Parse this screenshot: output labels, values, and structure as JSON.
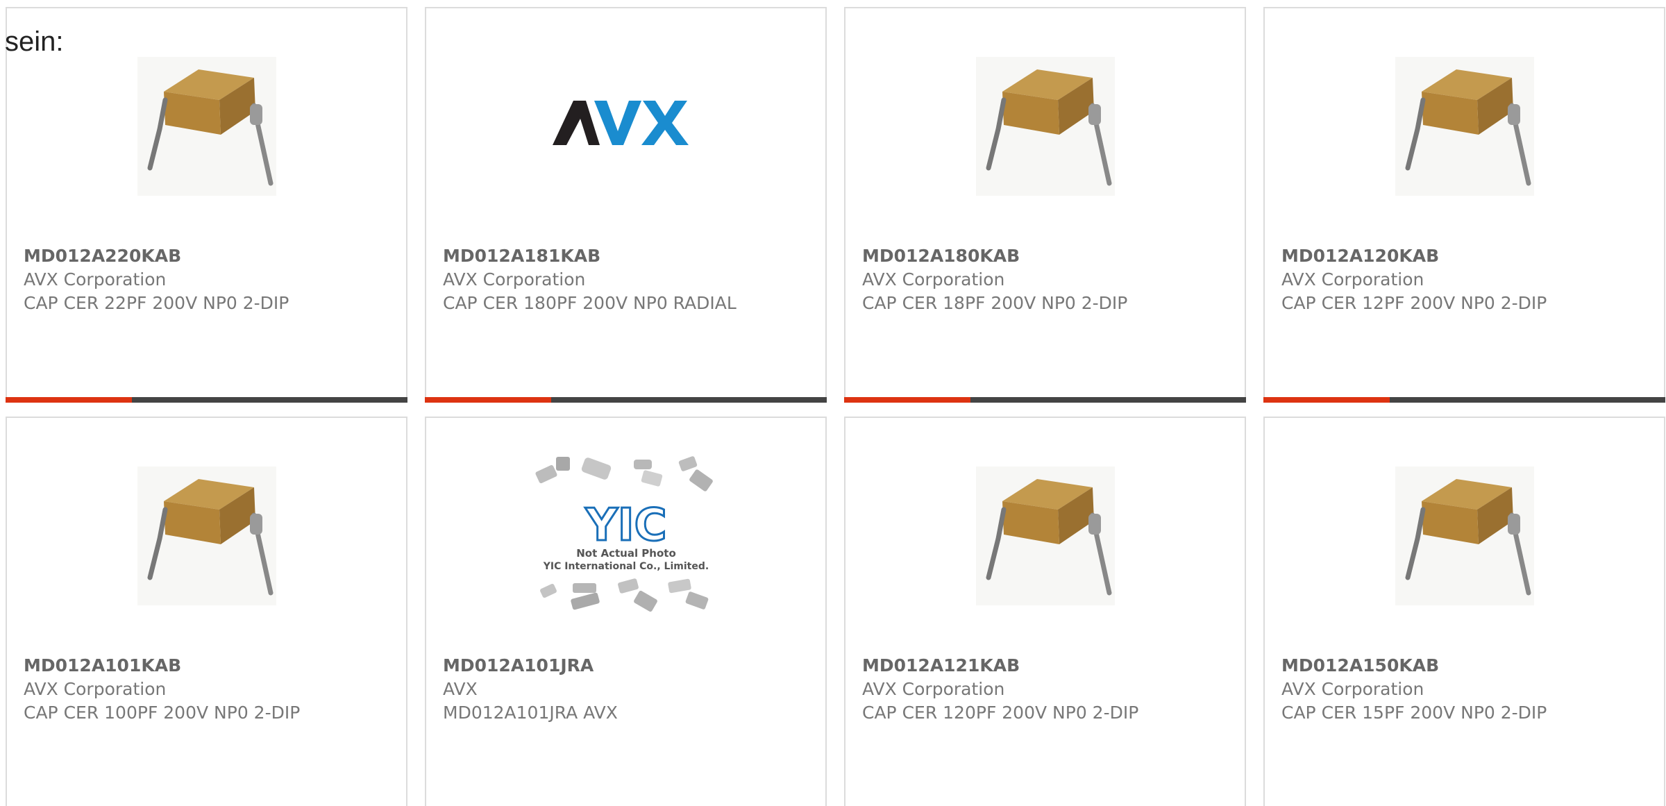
{
  "intro_text": "sein:",
  "colors": {
    "accent": "#dd3311",
    "bar_dark": "#444444",
    "card_border": "#dcdcdc",
    "text": "#777777"
  },
  "products": [
    {
      "part_number": "MD012A220KAB",
      "manufacturer": "AVX Corporation",
      "description": "CAP CER 22PF 200V NP0 2-DIP",
      "image": "capacitor-photo"
    },
    {
      "part_number": "MD012A181KAB",
      "manufacturer": "AVX Corporation",
      "description": "CAP CER 180PF 200V NP0 RADIAL",
      "image": "avx-logo",
      "logo_text": "AVX"
    },
    {
      "part_number": "MD012A180KAB",
      "manufacturer": "AVX Corporation",
      "description": "CAP CER 18PF 200V NP0 2-DIP",
      "image": "capacitor-photo"
    },
    {
      "part_number": "MD012A120KAB",
      "manufacturer": "AVX Corporation",
      "description": "CAP CER 12PF 200V NP0 2-DIP",
      "image": "capacitor-photo"
    },
    {
      "part_number": "MD012A101KAB",
      "manufacturer": "AVX Corporation",
      "description": "CAP CER 100PF 200V NP0 2-DIP",
      "image": "capacitor-photo"
    },
    {
      "part_number": "MD012A101JRA",
      "manufacturer": "AVX",
      "description": "MD012A101JRA AVX",
      "image": "yic-placeholder",
      "logo_text": "YIC",
      "placeholder_line1": "Not Actual Photo",
      "placeholder_line2": "YIC International Co., Limited."
    },
    {
      "part_number": "MD012A121KAB",
      "manufacturer": "AVX Corporation",
      "description": "CAP CER 120PF 200V NP0 2-DIP",
      "image": "capacitor-photo"
    },
    {
      "part_number": "MD012A150KAB",
      "manufacturer": "AVX Corporation",
      "description": "CAP CER 15PF 200V NP0 2-DIP",
      "image": "capacitor-photo"
    }
  ]
}
